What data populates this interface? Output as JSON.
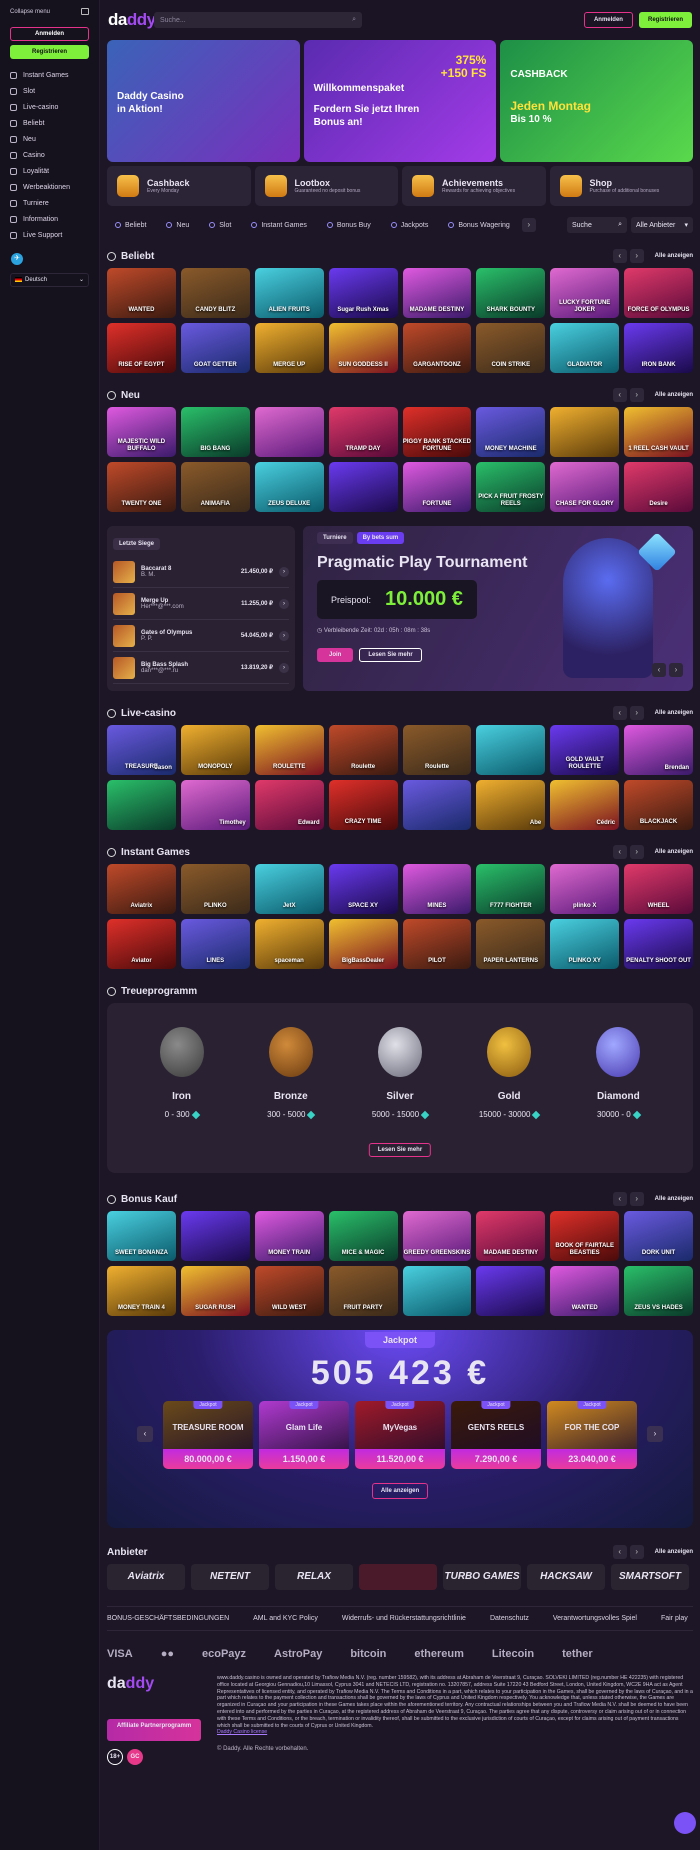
{
  "sidebar": {
    "collapse": "Collapse menu",
    "login": "Anmelden",
    "register": "Registrieren",
    "items": [
      "Instant Games",
      "Slot",
      "Live-casino",
      "Beliebt",
      "Neu",
      "Casino",
      "Loyalität",
      "Werbeaktionen",
      "Turniere",
      "Information",
      "Live Support"
    ],
    "language": "Deutsch"
  },
  "topbar": {
    "logo_a": "da",
    "logo_b": "ddy",
    "search_placeholder": "Suche...",
    "login": "Anmelden",
    "register": "Registrieren"
  },
  "banners": [
    {
      "line1": "Daddy Casino",
      "line2": "in Aktion!"
    },
    {
      "badge1": "375%",
      "badge2": "+150 FS",
      "title": "Willkommenspaket",
      "sub1": "Fordern Sie jetzt Ihren",
      "sub2": "Bonus an!"
    },
    {
      "title": "CASHBACK",
      "sub1": "Jeden Montag",
      "sub2": "Bis 10 %"
    }
  ],
  "features": [
    {
      "title": "Cashback",
      "sub": "Every Monday"
    },
    {
      "title": "Lootbox",
      "sub": "Guaranteed no deposit bonus"
    },
    {
      "title": "Achievements",
      "sub": "Rewards for achieving objectives"
    },
    {
      "title": "Shop",
      "sub": "Purchase of additional bonuses"
    }
  ],
  "categories": [
    "Beliebt",
    "Neu",
    "Slot",
    "Instant Games",
    "Bonus Buy",
    "Jackpots",
    "Bonus Wagering"
  ],
  "cat_search": "Suche",
  "cat_providers": "Alle Anbieter",
  "all_label": "Alle anzeigen",
  "sections": {
    "beliebt": "Beliebt",
    "neu": "Neu",
    "live": "Live-casino",
    "instant": "Instant Games",
    "loyalty": "Treueprogramm",
    "bonus": "Bonus Kauf",
    "providers": "Anbieter"
  },
  "games": {
    "beliebt": [
      "WANTED",
      "CANDY BLITZ",
      "ALIEN FRUITS",
      "Sugar Rush Xmas",
      "MADAME DESTINY",
      "SHARK BOUNTY",
      "LUCKY FORTUNE JOKER",
      "FORCE OF OLYMPUS",
      "RISE OF EGYPT",
      "GOAT GETTER",
      "MERGE UP",
      "SUN GODDESS II",
      "GARGANTOONZ",
      "COIN STRIKE",
      "GLADIATOR",
      "IRON BANK"
    ],
    "neu": [
      "MAJESTIC WILD BUFFALO",
      "BIG BANG",
      "",
      "TRAMP DAY",
      "PIGGY BANK STACKED FORTUNE",
      "MONEY MACHINE",
      "",
      "1 REEL CASH VAULT",
      "TWENTY ONE",
      "ANIMAFIA",
      "ZEUS DELUXE",
      "",
      "FORTUNE",
      "PICK A FRUIT FROSTY REELS",
      "CHASE FOR GLORY",
      "Desire"
    ],
    "live": [
      "TREASURE",
      "MONOPOLY",
      "ROULETTE",
      "Roulette",
      "Roulette",
      "",
      "GOLD VAULT ROULETTE",
      "",
      "",
      "",
      "",
      "CRAZY TIME",
      "",
      "",
      "",
      "BLACKJACK"
    ],
    "live_names": [
      "Jason",
      "",
      "",
      "",
      "",
      "",
      "",
      "Brendan",
      "",
      "Timothey",
      "Edward",
      "",
      "",
      "Abe",
      "Cédric",
      ""
    ],
    "instant": [
      "Aviatrix",
      "PLINKO",
      "JetX",
      "SPACE XY",
      "MINES",
      "F777 FIGHTER",
      "plinko X",
      "WHEEL",
      "Aviator",
      "LINES",
      "spaceman",
      "BigBassDealer",
      "PILOT",
      "PAPER LANTERNS",
      "PLINKO XY",
      "PENALTY SHOOT OUT"
    ],
    "bonus": [
      "SWEET BONANZA",
      "",
      "MONEY TRAIN",
      "MICE & MAGIC",
      "GREEDY GREENSKINS",
      "MADAME DESTINY",
      "BOOK OF FAIRTALE BEASTIES",
      "DORK UNIT",
      "MONEY TRAIN 4",
      "SUGAR RUSH",
      "WILD WEST",
      "FRUIT PARTY",
      "",
      "",
      "WANTED",
      "ZEUS VS HADES"
    ]
  },
  "winners": {
    "tab": "Letzte Siege",
    "rows": [
      {
        "game": "Baccarat 8",
        "user": "B. M.",
        "amount": "21.450,00 ₽"
      },
      {
        "game": "Merge Up",
        "user": "Her***@***.com",
        "amount": "11.255,00 ₽"
      },
      {
        "game": "Gates of Olympus",
        "user": "P. P.",
        "amount": "54.045,00 ₽"
      },
      {
        "game": "Big Bass Splash",
        "user": "dan***@***.ru",
        "amount": "13.819,20 ₽"
      }
    ]
  },
  "tournament": {
    "tab1": "Turniere",
    "tab2": "By bets sum",
    "title": "Pragmatic Play Tournament",
    "pool_label": "Preispool:",
    "pool_value": "10.000 €",
    "time": "Verbleibende Zeit: 02d : 05h : 08m : 38s",
    "join": "Join",
    "more": "Lesen Sie mehr"
  },
  "loyalty": {
    "levels": [
      {
        "name": "Iron",
        "range": "0 - 300"
      },
      {
        "name": "Bronze",
        "range": "300 - 5000"
      },
      {
        "name": "Silver",
        "range": "5000 - 15000"
      },
      {
        "name": "Gold",
        "range": "15000 - 30000"
      },
      {
        "name": "Diamond",
        "range": "30000 - 0"
      }
    ],
    "more": "Lesen Sie mehr"
  },
  "jackpot": {
    "tab": "Jackpot",
    "amount": "505 423 €",
    "card_label": "Jackpot",
    "cards": [
      "80.000,00 €",
      "1.150,00 €",
      "11.520,00 €",
      "7.290,00 €",
      "23.040,00 €"
    ],
    "card_titles": [
      "TREASURE ROOM",
      "Glam Life",
      "MyVegas",
      "GENTS REELS",
      "FOR THE COP"
    ],
    "all": "Alle anzeigen"
  },
  "providers": [
    "Aviatrix",
    "NETENT",
    "RELAX",
    "",
    "TURBO GAMES",
    "HACKSAW",
    "SMARTSOFT"
  ],
  "links": [
    "BONUS-GESCHÄFTSBEDINGUNGEN",
    "AML and KYC Policy",
    "Widerrufs- und Rückerstattungsrichtlinie",
    "Datenschutz",
    "Verantwortungsvolles Spiel",
    "Fair play"
  ],
  "payments": [
    "VISA",
    "●●",
    "ecoPayz",
    "AstroPay",
    "bitcoin",
    "ethereum",
    "Litecoin",
    "tether"
  ],
  "footer": {
    "logo_a": "da",
    "logo_b": "ddy",
    "affiliate": "Affiliate Partnerprogramm",
    "text": "www.daddy.casino is owned and operated by Trafiow Media N.V. (reg. number 159582), with its address at Abraham de Veerstraat 9, Curaçao. SOLVEKI LIMITED (reg.number HE 422235) with registered office located at Georgiou Gennadiou,10 Limassol, Cyprus 3041 and NETECIS LTD, registration no. 13207857, address Suite 17220 43 Bedford Street, London, United Kingdom, WC2E 9HA act as Agent Representatives of licensed entity, and operated by Trafiow Media N.V. The Terms and Conditions in a part, which relates to your participation in the Games, shall be governed by the laws of Curaçao, and in a part which relates to the payment collection and transactions shall be governed by the laws of Cyprus and United Kingdom respectively. You acknowledge that, unless stated otherwise, the Games are organized in Curaçao and your participation in these Games takes place within the aforementioned territory. Any contractual relationships between you and Trafiow Media N.V. shall be deemed to have been entered into and performed by the parties in Curaçao, at the registered address of Abraham de Veerstraat 9, Curaçao. The parties agree that any dispute, controversy or claim arising out of or in connection with these Terms and Conditions, or the breach, termination or invalidity thereof, shall be submitted to the exclusive jurisdiction of courts of Curaçao, except for claims arising out of payment transactions which shall be submitted to the courts of Cyprus or United Kingdom.",
    "license": "Daddy Casino license",
    "copyright": "© Daddy. Alle Rechte vorbehalten."
  }
}
